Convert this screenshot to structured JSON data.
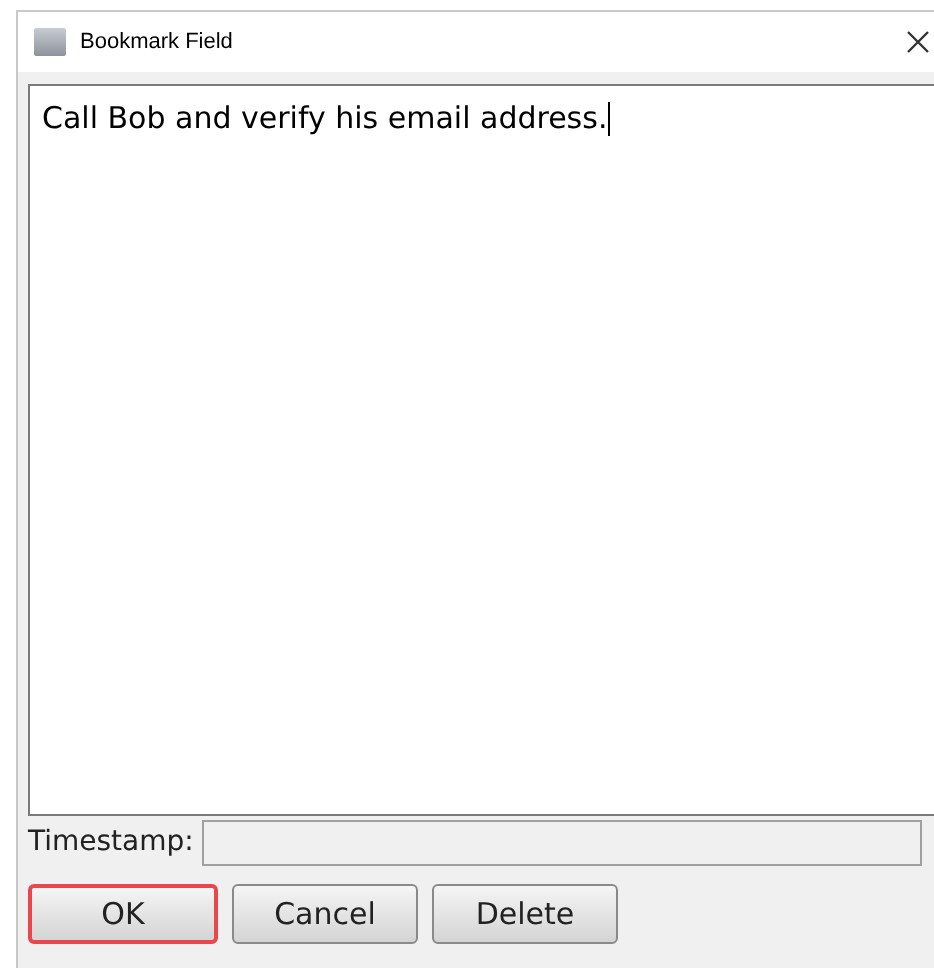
{
  "window": {
    "title": "Bookmark Field"
  },
  "text_area": {
    "value": "Call Bob and verify his email address."
  },
  "timestamp": {
    "label": "Timestamp:"
  },
  "buttons": [
    {
      "label": "OK",
      "highlighted": true
    },
    {
      "label": "Cancel",
      "highlighted": false
    },
    {
      "label": "Delete",
      "highlighted": false
    }
  ]
}
